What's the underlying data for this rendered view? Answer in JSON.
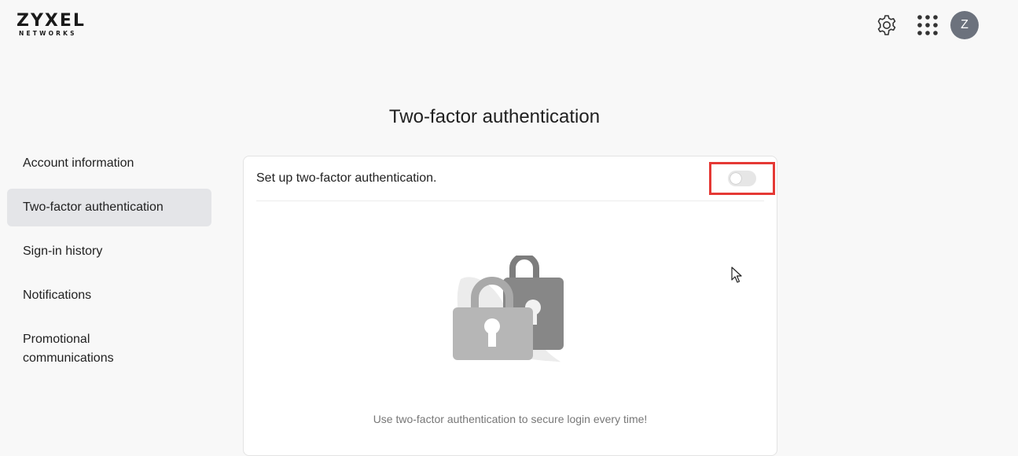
{
  "header": {
    "logo_main": "ZYXEL",
    "logo_sub": "NETWORKS",
    "settings_icon": "gear-icon",
    "apps_icon": "apps-grid-icon",
    "avatar_initial": "Z"
  },
  "page": {
    "title": "Two-factor authentication"
  },
  "sidebar": {
    "items": [
      {
        "label": "Account information",
        "active": false
      },
      {
        "label": "Two-factor authentication",
        "active": true
      },
      {
        "label": "Sign-in history",
        "active": false
      },
      {
        "label": "Notifications",
        "active": false
      },
      {
        "label": "Promotional communications",
        "active": false
      }
    ]
  },
  "card": {
    "setup_label": "Set up two-factor authentication.",
    "toggle_on": false,
    "illustration_icon": "padlocks-icon",
    "hint": "Use two-factor authentication to secure login every time!"
  },
  "colors": {
    "highlight": "#e53935",
    "active_bg": "#e4e5e8",
    "avatar_bg": "#6c727d"
  }
}
